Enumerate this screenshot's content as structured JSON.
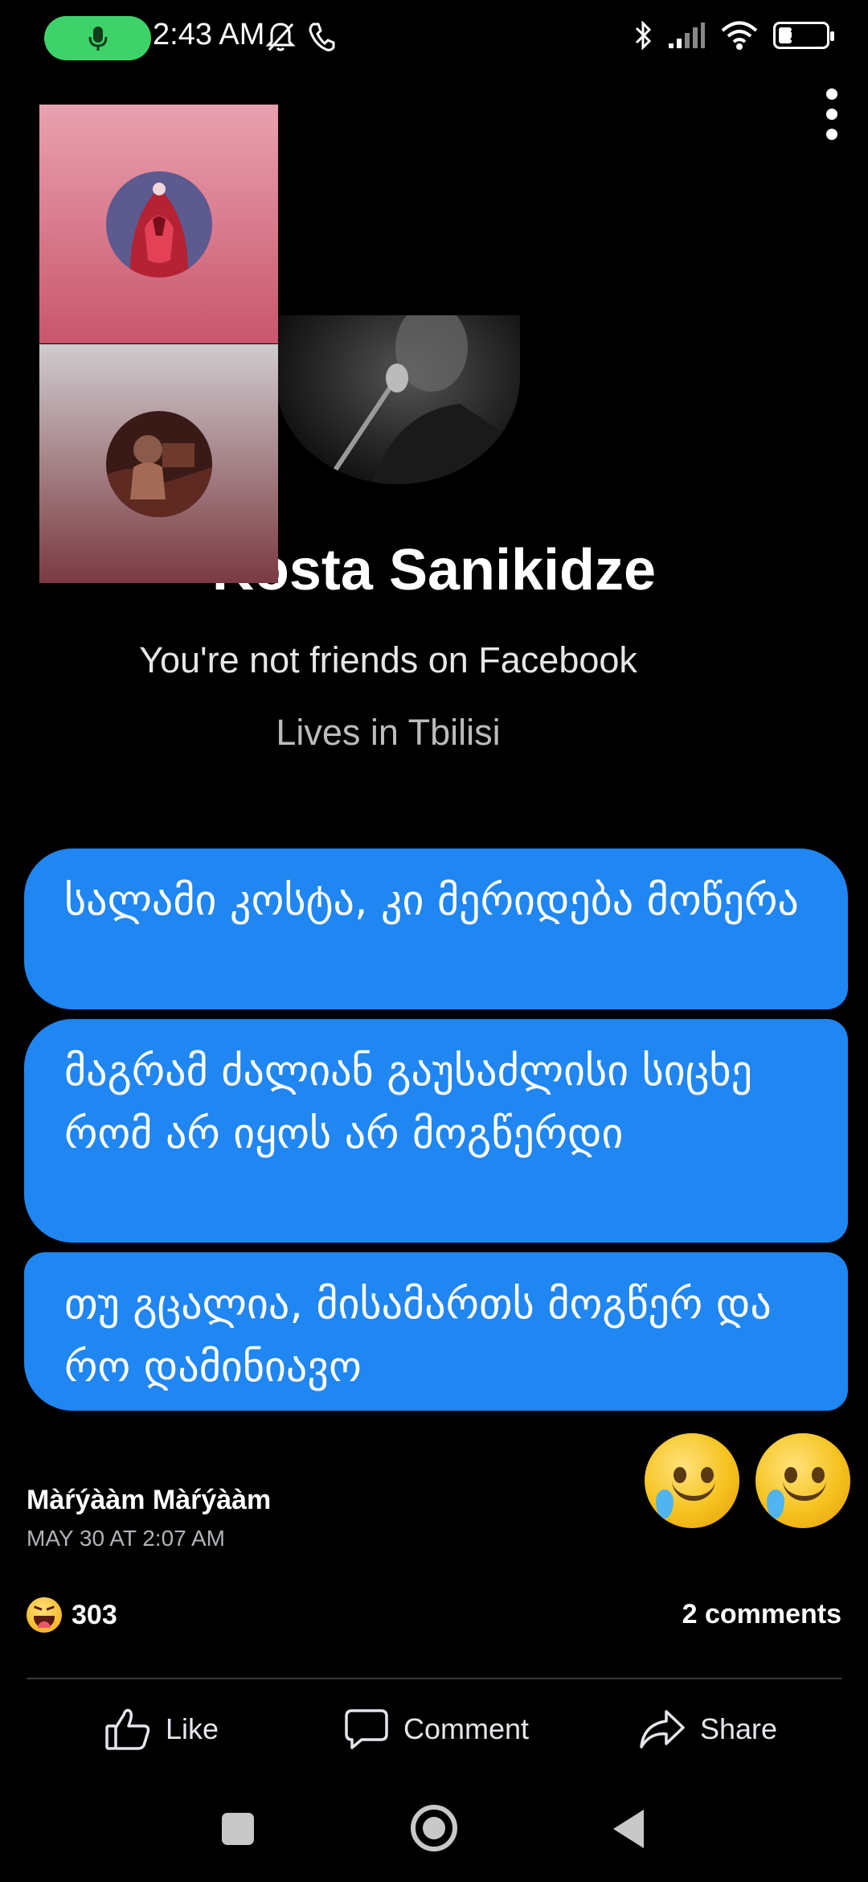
{
  "status_bar": {
    "time": "2:43 AM",
    "battery_level": "25",
    "icons": [
      "mic-icon",
      "bell-muted-icon",
      "phone-icon",
      "bluetooth-icon",
      "signal-icon",
      "wifi-icon",
      "battery-icon"
    ],
    "mic_pill_color": "#3ed36a"
  },
  "call_tiles": [
    {
      "avatar": "avatar-red-figure",
      "bg_top": "#e9a1b0",
      "bg_bottom": "#c9566c"
    },
    {
      "avatar": "avatar-dark-photo",
      "bg_top": "#cfcbce",
      "bg_bottom": "#7a3a41"
    }
  ],
  "profile": {
    "name": "Kosta Sanikidze",
    "friend_status": "You're not friends on Facebook",
    "location": "Lives in Tbilisi"
  },
  "messages": [
    {
      "text": "სალამი კოსტა, კი მერიდება მოწერა"
    },
    {
      "text": "მაგრამ ძალიან გაუსაძლისი სიცხე რომ არ იყოს არ მოგწერდი"
    },
    {
      "text": "თუ გცალია, მისამართს მოგწერ და რო დამინიავო"
    }
  ],
  "message_bubble_color": "#1f86f2",
  "emoji_reactions": [
    "smiling-face-with-tear-icon",
    "smiling-face-with-tear-icon"
  ],
  "post": {
    "author": "Màŕýààm Màŕýààm",
    "date": "MAY 30 AT 2:07 AM",
    "reaction_icon": "haha-icon",
    "reaction_count": "303",
    "comments": "2 comments"
  },
  "actions": {
    "like": "Like",
    "comment": "Comment",
    "share": "Share"
  },
  "nav": [
    "recents-icon",
    "home-icon",
    "back-icon"
  ]
}
